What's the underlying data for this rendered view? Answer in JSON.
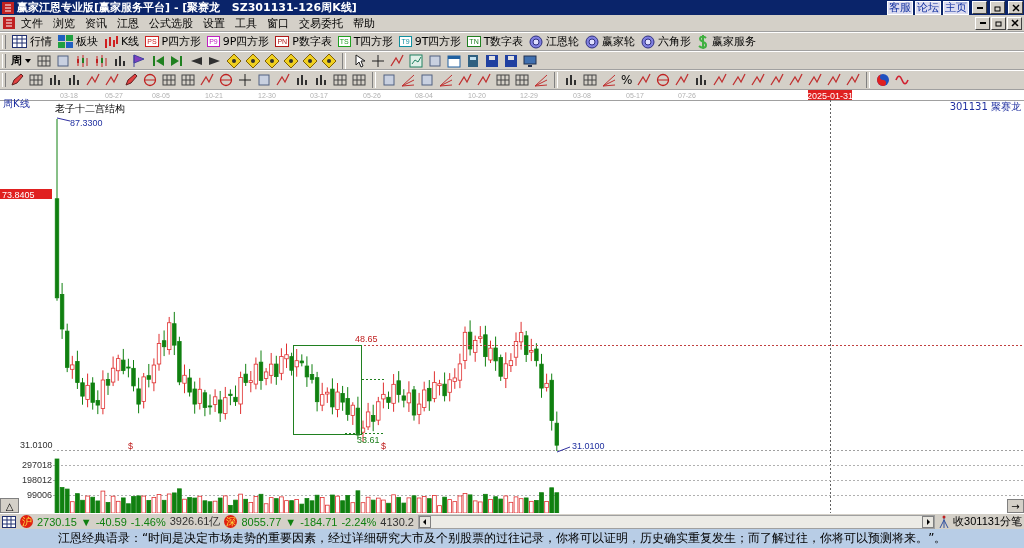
{
  "window": {
    "title": "赢家江恩专业版[赢家服务平台] - [聚赛龙   SZ301131-126周K线]",
    "links": [
      "客服",
      "论坛",
      "主页"
    ]
  },
  "menu": {
    "items": [
      "文件",
      "浏览",
      "资讯",
      "江恩",
      "公式选股",
      "设置",
      "工具",
      "窗口",
      "交易委托",
      "帮助"
    ]
  },
  "toolbar": {
    "items": [
      {
        "label": "行情",
        "kind": "table"
      },
      {
        "label": "板块",
        "kind": "blocks"
      },
      {
        "label": "K线",
        "kind": "candles"
      },
      {
        "label": "P四方形",
        "kind": "badge",
        "badge": "PS",
        "color": "#d02020"
      },
      {
        "label": "9P四方形",
        "kind": "badge",
        "badge": "P9",
        "color": "#c020c0"
      },
      {
        "label": "P数字表",
        "kind": "badge",
        "badge": "PN",
        "color": "#b01818"
      },
      {
        "label": "T四方形",
        "kind": "badge",
        "badge": "TS",
        "color": "#20a020"
      },
      {
        "label": "9T四方形",
        "kind": "badge",
        "badge": "T9",
        "color": "#1090a0"
      },
      {
        "label": "T数字表",
        "kind": "badge",
        "badge": "TN",
        "color": "#208020"
      },
      {
        "label": "江恩轮",
        "kind": "wheel"
      },
      {
        "label": "赢家轮",
        "kind": "wheel"
      },
      {
        "label": "六角形",
        "kind": "wheel"
      },
      {
        "label": "赢家服务",
        "kind": "dollar"
      }
    ]
  },
  "drawing_tools": {
    "period": "周",
    "percent": "%"
  },
  "chart": {
    "period_label": "周K线",
    "title": "老子十二宫结构",
    "stock_code": "301131",
    "stock_name": "聚赛龙",
    "dates": [
      "03-18",
      "05-27",
      "08-05",
      "10-21",
      "12-30",
      "03-17",
      "05-26",
      "08-04",
      "10-20",
      "12-29",
      "03-08",
      "05-17",
      "07-26"
    ],
    "cursor_date": "2025-01-31",
    "cursor_price": "73.8405",
    "high_label": "87.3300",
    "low_label": "31.0100",
    "axis_low": "31.0100",
    "annotations": [
      {
        "text": "48.65",
        "kind": "resistance"
      },
      {
        "text": "33.61",
        "kind": "support"
      }
    ],
    "signals": [
      "$",
      "$"
    ],
    "volume_ticks": [
      "297018",
      "198012",
      "99006"
    ],
    "zoom_button": "△",
    "scroll_button": "→"
  },
  "status_bar": {
    "indices": [
      {
        "badge": "沪",
        "value": "2730.15",
        "arrow": "▼",
        "change": "-40.59",
        "percent": "-1.46%",
        "amount": "3926.61亿"
      },
      {
        "badge": "深",
        "value": "8055.77",
        "arrow": "▼",
        "change": "-184.71",
        "percent": "-2.24%",
        "amount": "4130.2"
      }
    ],
    "receive": "收301131分笔"
  },
  "quote": "江恩经典语录：“时间是决定市场走势的重要因素，经过详细研究大市及个别股票的过往记录，你将可以证明，历史确实重复发生；而了解过往，你将可以预测将来。”。"
}
